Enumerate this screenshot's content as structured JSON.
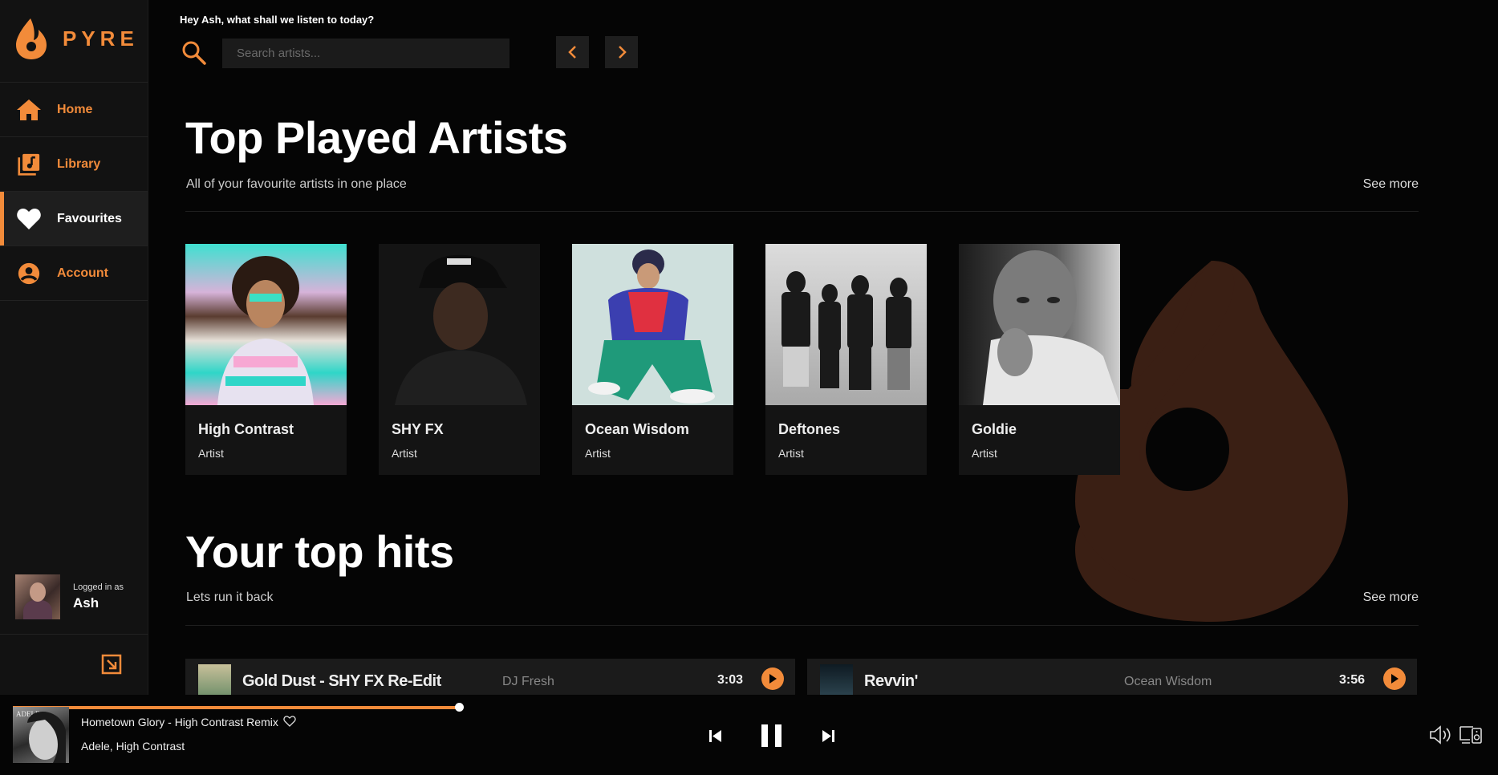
{
  "app": {
    "name": "PYRE",
    "accent": "#f28b3a"
  },
  "sidebar": {
    "items": [
      {
        "label": "Home",
        "icon": "home-icon",
        "active": false
      },
      {
        "label": "Library",
        "icon": "library-icon",
        "active": false
      },
      {
        "label": "Favourites",
        "icon": "heart-icon",
        "active": true
      },
      {
        "label": "Account",
        "icon": "account-icon",
        "active": false
      }
    ],
    "user": {
      "logged_in_label": "Logged in as",
      "name": "Ash"
    },
    "collapse_icon": "collapse-icon"
  },
  "header": {
    "greeting": "Hey Ash, what shall we listen to today?",
    "search_placeholder": "Search artists..."
  },
  "top_artists": {
    "title": "Top Played Artists",
    "subtitle": "All of your favourite artists in one place",
    "see_more": "See more",
    "items": [
      {
        "name": "High Contrast",
        "type": "Artist"
      },
      {
        "name": "SHY FX",
        "type": "Artist"
      },
      {
        "name": "Ocean Wisdom",
        "type": "Artist"
      },
      {
        "name": "Deftones",
        "type": "Artist"
      },
      {
        "name": "Goldie",
        "type": "Artist"
      }
    ]
  },
  "top_hits": {
    "title": "Your top hits",
    "subtitle": "Lets run it back",
    "see_more": "See more",
    "tracks": [
      {
        "title": "Gold Dust - SHY FX Re-Edit",
        "artist": "DJ Fresh",
        "duration": "3:03"
      },
      {
        "title": "Revvin'",
        "artist": "Ocean Wisdom",
        "duration": "3:56"
      }
    ]
  },
  "player": {
    "title": "Hometown Glory - High Contrast Remix",
    "artists": "Adele, High Contrast",
    "album_label": "ADELE",
    "progress": 0.327,
    "favourite_icon": "heart-outline-icon"
  }
}
